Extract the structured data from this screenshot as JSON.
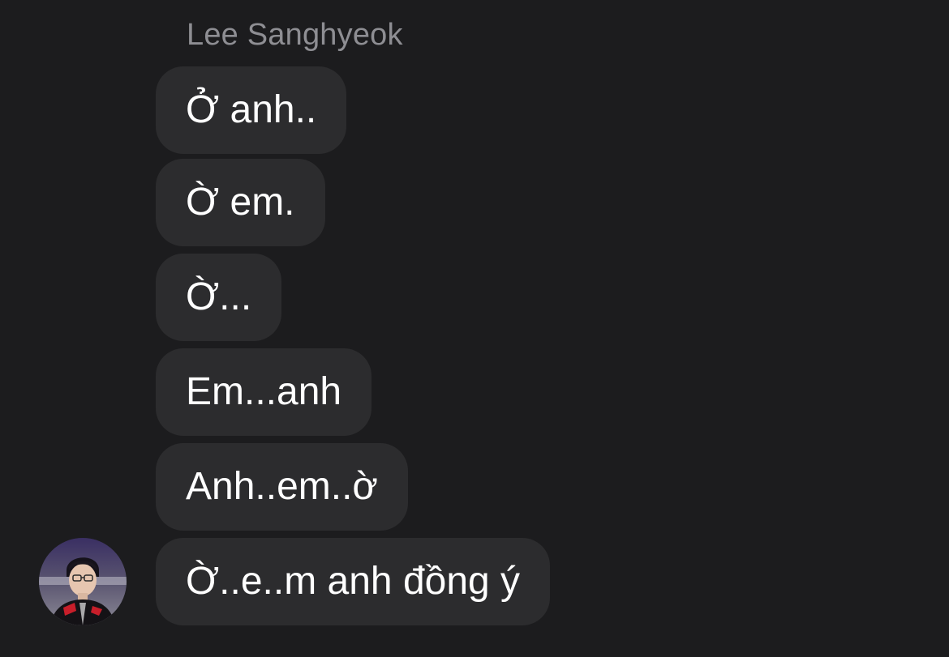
{
  "sender": {
    "name": "Lee Sanghyeok"
  },
  "messages": [
    {
      "text": "Ở anh.."
    },
    {
      "text": "Ờ em."
    },
    {
      "text": "Ờ..."
    },
    {
      "text": "Em...anh"
    },
    {
      "text": "Anh..em..ờ"
    },
    {
      "text": "Ờ..e..m anh đồng ý"
    }
  ],
  "colors": {
    "background": "#1c1c1e",
    "bubble": "#2c2c2e",
    "sender_name": "#8e8e93",
    "message_text": "#ffffff"
  }
}
